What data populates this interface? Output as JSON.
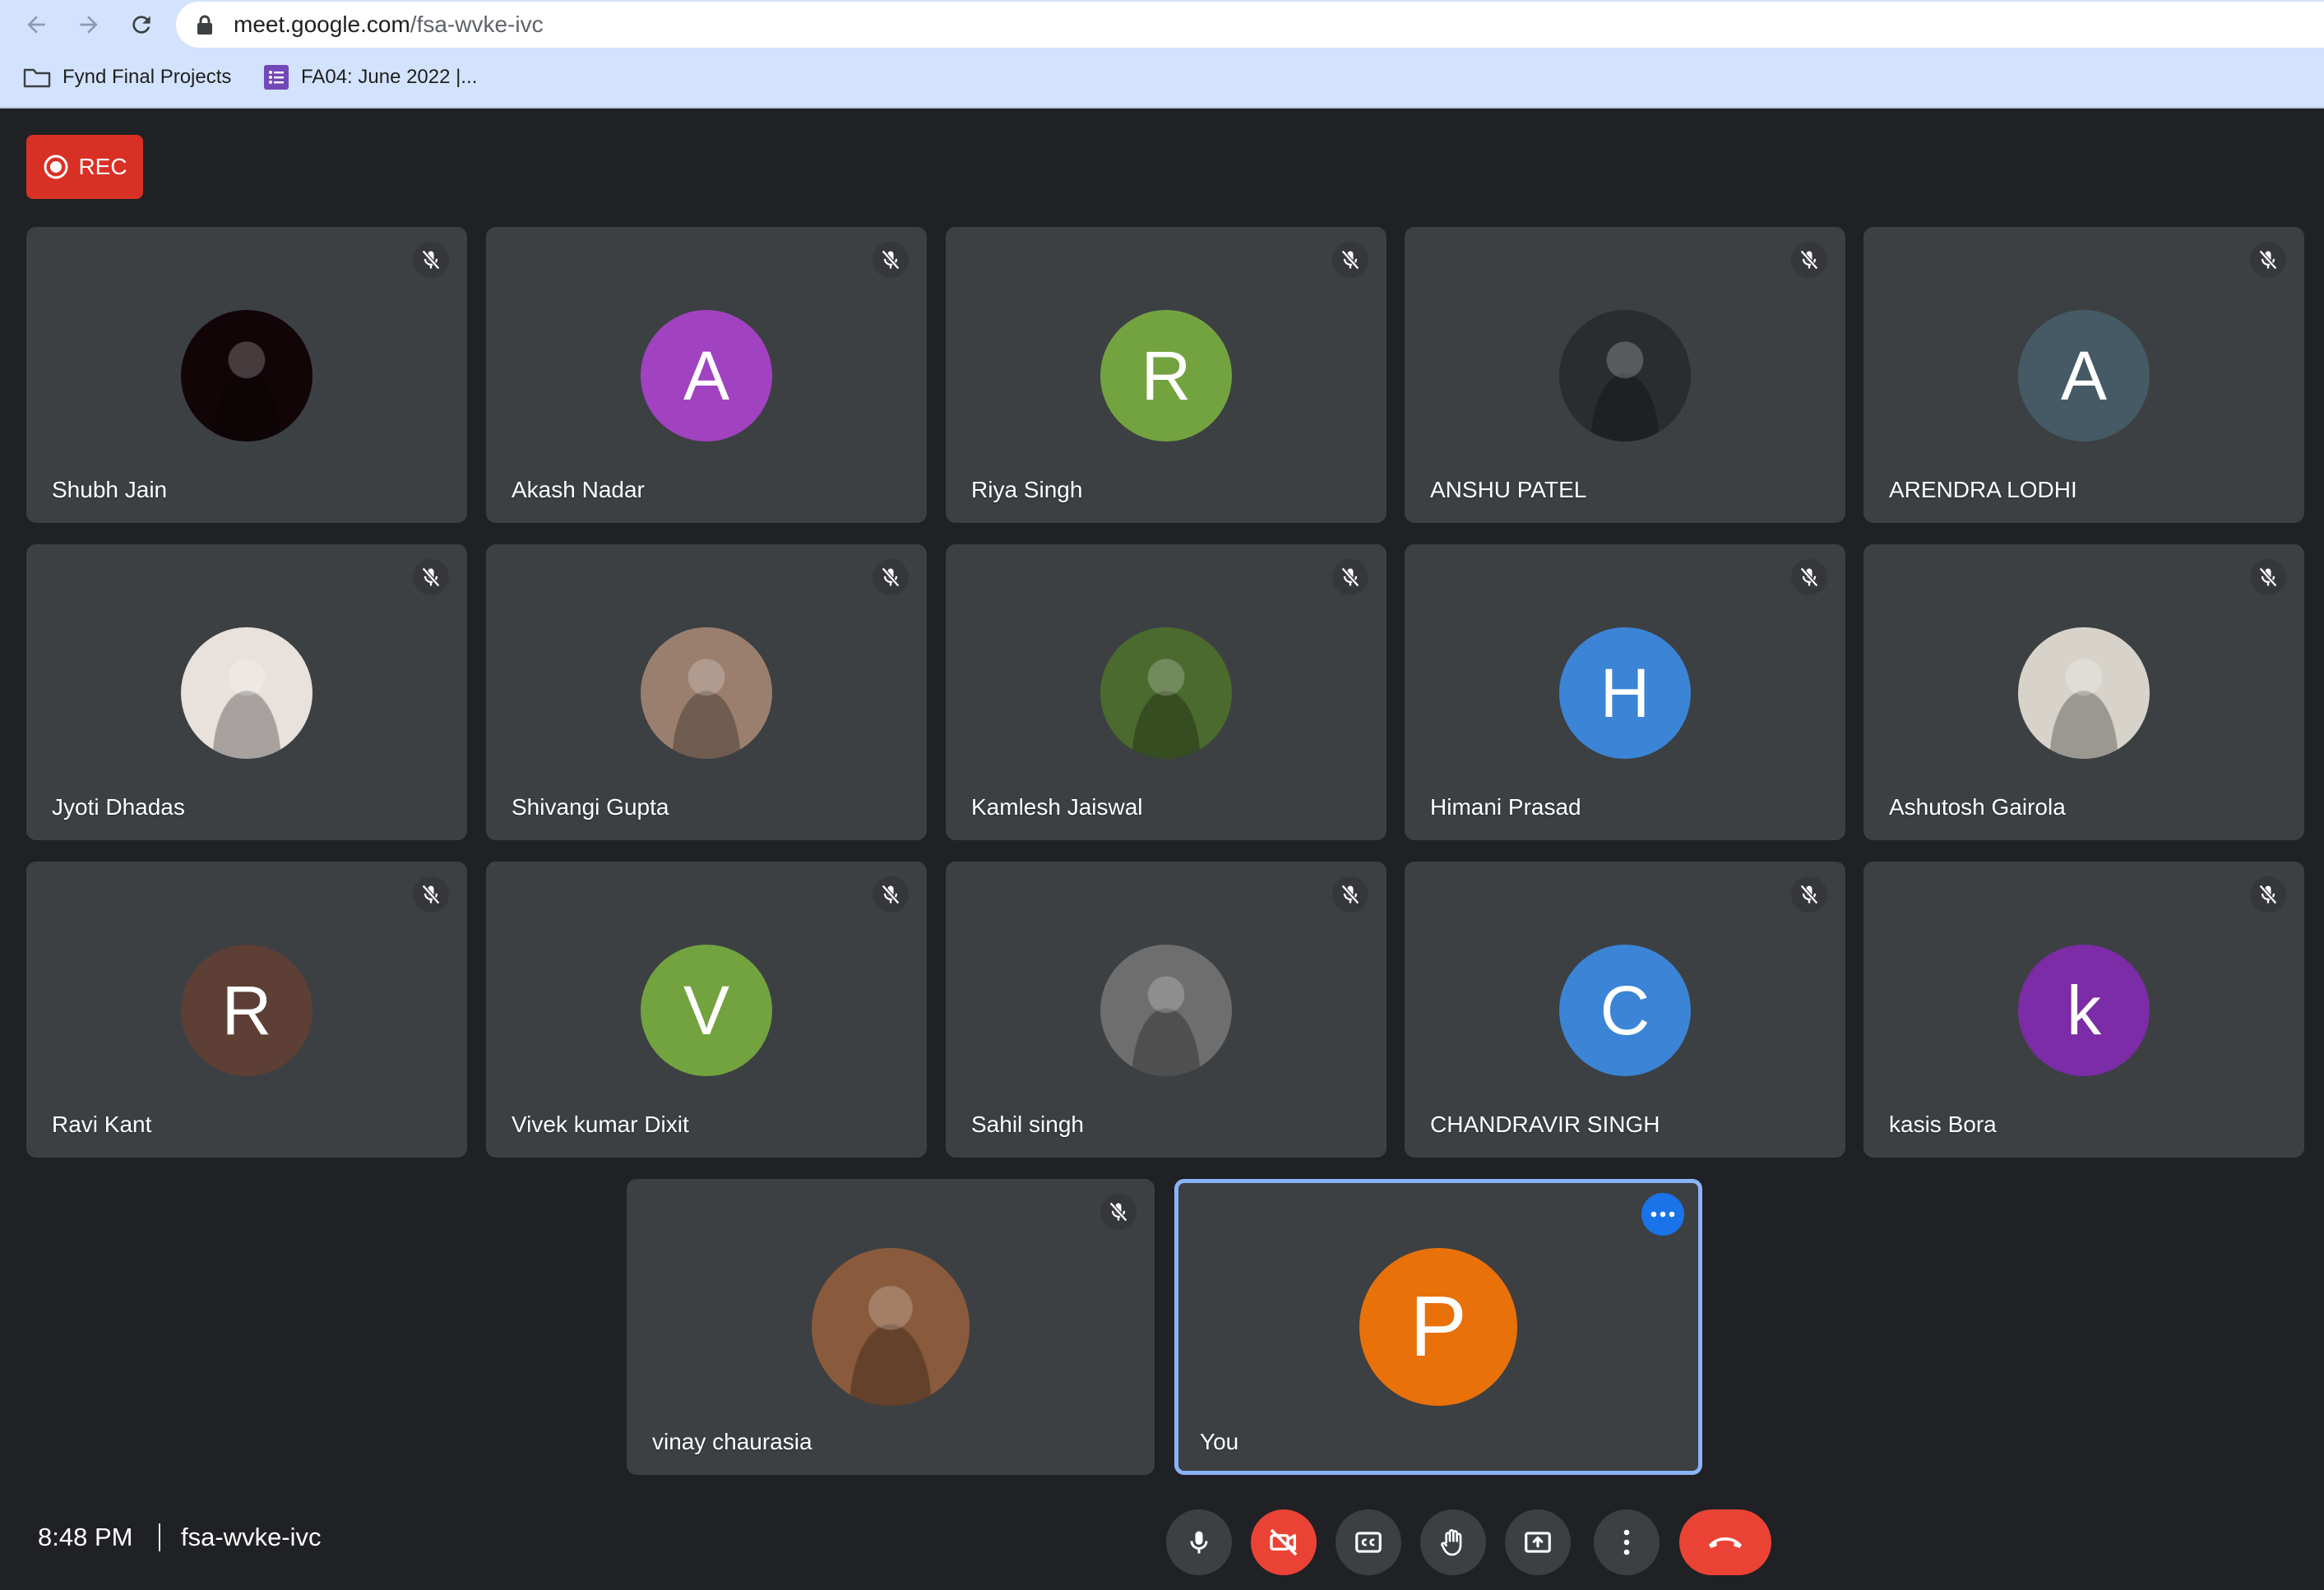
{
  "browser": {
    "url_host": "meet.google.com",
    "url_path": "/fsa-wvke-ivc",
    "bookmarks": [
      {
        "label": "Fynd Final Projects",
        "icon": "folder-icon"
      },
      {
        "label": "FA04: June 2022 |...",
        "icon": "google-forms-icon"
      }
    ]
  },
  "meeting": {
    "rec_label": "REC",
    "time": "8:48 PM",
    "code": "fsa-wvke-ivc"
  },
  "participants": [
    {
      "name": "Shubh Jain",
      "avatar_type": "photo",
      "avatar_color": "#120508",
      "muted": true
    },
    {
      "name": "Akash Nadar",
      "avatar_type": "initial",
      "initial": "A",
      "avatar_color": "#a142c1",
      "muted": true
    },
    {
      "name": "Riya Singh",
      "avatar_type": "initial",
      "initial": "R",
      "avatar_color": "#73a33f",
      "muted": true
    },
    {
      "name": "ANSHU PATEL",
      "avatar_type": "photo",
      "avatar_color": "#2a2c30",
      "muted": true
    },
    {
      "name": "ARENDRA LODHI",
      "avatar_type": "initial",
      "initial": "A",
      "avatar_color": "#465a65",
      "muted": true
    },
    {
      "name": "Jyoti Dhadas",
      "avatar_type": "photo",
      "avatar_color": "#e8e1dc",
      "muted": true
    },
    {
      "name": "Shivangi Gupta",
      "avatar_type": "photo",
      "avatar_color": "#9b7f6e",
      "muted": true
    },
    {
      "name": "Kamlesh Jaiswal",
      "avatar_type": "photo",
      "avatar_color": "#4b6a2e",
      "muted": true
    },
    {
      "name": "Himani Prasad",
      "avatar_type": "initial",
      "initial": "H",
      "avatar_color": "#3b84d6",
      "muted": true
    },
    {
      "name": "Ashutosh Gairola",
      "avatar_type": "photo",
      "avatar_color": "#d7d2ca",
      "muted": true
    },
    {
      "name": "Ravi Kant",
      "avatar_type": "initial",
      "initial": "R",
      "avatar_color": "#5d3f35",
      "muted": true
    },
    {
      "name": "Vivek kumar Dixit",
      "avatar_type": "initial",
      "initial": "V",
      "avatar_color": "#73a33f",
      "muted": true
    },
    {
      "name": "Sahil singh",
      "avatar_type": "photo",
      "avatar_color": "#6e6e6e",
      "muted": true
    },
    {
      "name": "CHANDRAVIR SINGH",
      "avatar_type": "initial",
      "initial": "C",
      "avatar_color": "#3b84d6",
      "muted": true
    },
    {
      "name": "kasis Bora",
      "avatar_type": "initial",
      "initial": "k",
      "avatar_color": "#7b2ca6",
      "muted": true
    },
    {
      "name": "vinay chaurasia",
      "avatar_type": "photo",
      "avatar_color": "#8a5a3c",
      "muted": true
    }
  ],
  "self": {
    "name": "You",
    "initial": "P",
    "avatar_color": "#e8710a"
  },
  "controls": {
    "mic_icon": "microphone-icon",
    "camera_icon": "camera-off-icon",
    "captions_icon": "closed-captions-icon",
    "raise_hand_icon": "raise-hand-icon",
    "present_icon": "present-screen-icon",
    "more_icon": "more-vert-icon",
    "leave_icon": "end-call-icon",
    "camera_off_color": "#ea4335",
    "leave_color": "#ea4335"
  }
}
